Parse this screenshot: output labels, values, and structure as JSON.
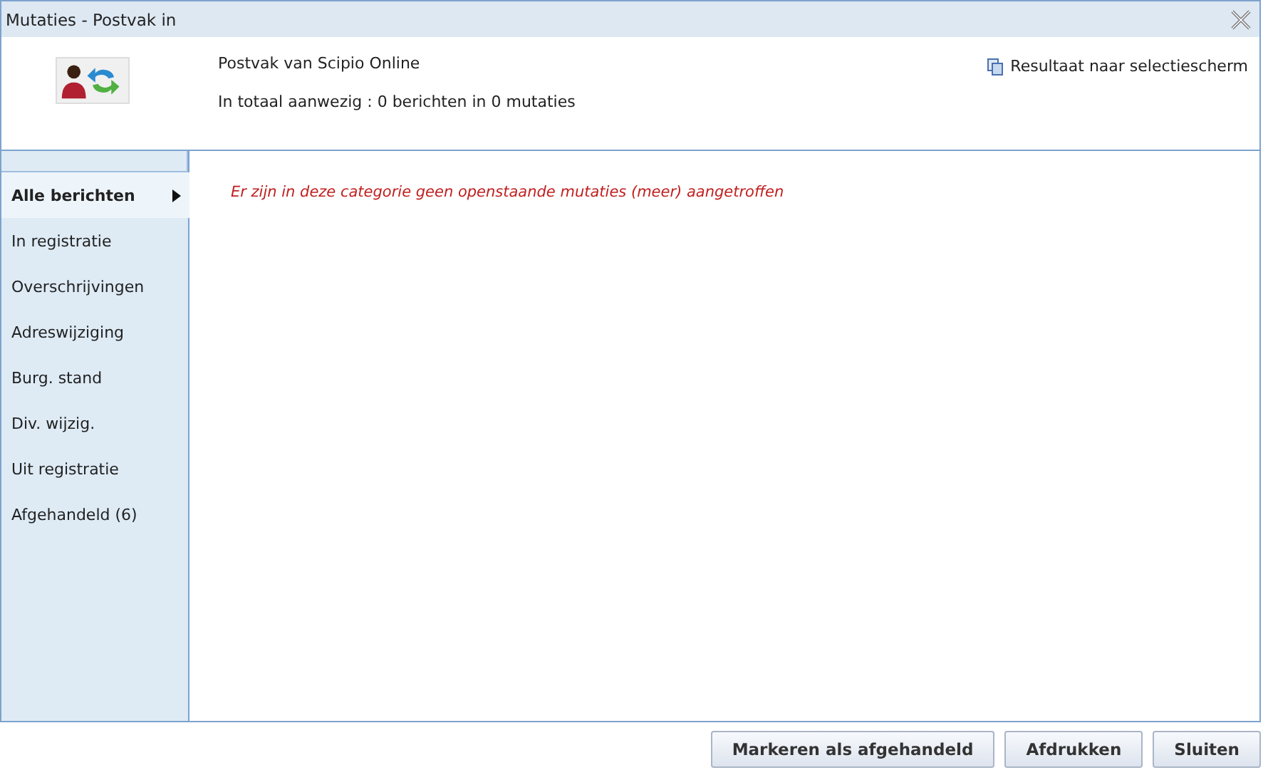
{
  "window": {
    "title": "Mutaties - Postvak in"
  },
  "header": {
    "source": "Postvak van Scipio Online",
    "summary": "In totaal aanwezig : 0 berichten in 0 mutaties",
    "link": "Resultaat naar selectiescherm"
  },
  "sidebar": {
    "items": [
      {
        "label": "Alle berichten",
        "selected": true
      },
      {
        "label": "In registratie",
        "selected": false
      },
      {
        "label": "Overschrijvingen",
        "selected": false
      },
      {
        "label": "Adreswijziging",
        "selected": false
      },
      {
        "label": "Burg. stand",
        "selected": false
      },
      {
        "label": "Div. wijzig.",
        "selected": false
      },
      {
        "label": "Uit registratie",
        "selected": false
      },
      {
        "label": "Afgehandeld (6)",
        "selected": false
      }
    ]
  },
  "message": "Er zijn in deze categorie geen openstaande mutaties (meer) aangetroffen",
  "buttons": [
    "Markeren als afgehandeld",
    "Afdrukken",
    "Sluiten"
  ]
}
